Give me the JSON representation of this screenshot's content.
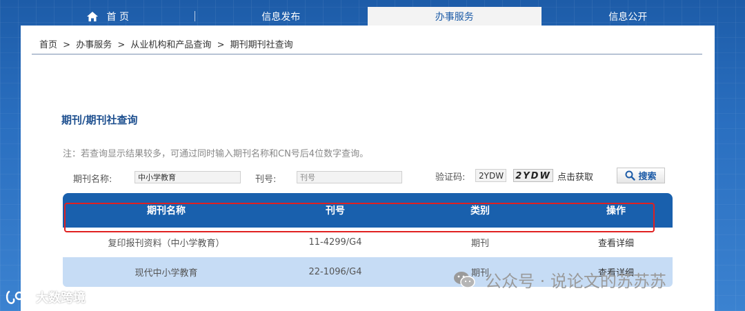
{
  "nav": {
    "items": [
      {
        "label": "首 页"
      },
      {
        "label": "信息发布"
      },
      {
        "label": "办事服务"
      },
      {
        "label": "信息公开"
      }
    ]
  },
  "breadcrumb": [
    "首页",
    ">",
    "办事服务",
    ">",
    "从业机构和产品查询",
    ">",
    "期刊期刊社查询"
  ],
  "page_title": "期刊/期刊社查询",
  "note": "注：若查询显示结果较多，可通过同时输入期刊名称和CN号后4位数字查询。",
  "form": {
    "name_label": "期刊名称:",
    "name_value": "中小学教育",
    "issn_label": "刊号:",
    "issn_placeholder": "刊号",
    "captcha_label": "验证码:",
    "captcha_value": "2YDW",
    "captcha_image_text": "2YDW",
    "refresh_label": "点击获取",
    "search_label": "搜索"
  },
  "table": {
    "headers": [
      "期刊名称",
      "刊号",
      "类别",
      "操作"
    ],
    "rows": [
      {
        "name": "复印报刊资料（中小学教育）",
        "cn": "11-4299/G4",
        "type": "期刊",
        "action": "查看详细"
      },
      {
        "name": "现代中小学教育",
        "cn": "22-1096/G4",
        "type": "期刊",
        "action": "查看详细"
      }
    ]
  },
  "watermark": "公众号 · 说论文的苏苏苏",
  "brand": "大数跨境",
  "colors": {
    "primary": "#1960ad",
    "highlight": "#e02020",
    "row_alt": "#c6dcf5"
  }
}
